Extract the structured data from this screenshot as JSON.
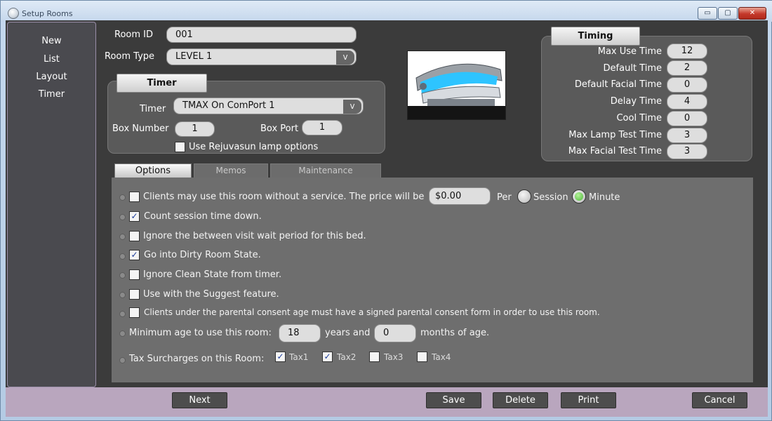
{
  "window": {
    "title": "Setup Rooms",
    "minimize": "▭",
    "maximize": "▢",
    "close": "✕"
  },
  "sidebar": {
    "items": [
      "New",
      "List",
      "Layout",
      "Timer"
    ]
  },
  "room": {
    "id_label": "Room ID",
    "id_value": "001",
    "type_label": "Room Type",
    "type_value": "LEVEL 1",
    "dropdown_glyph": "v"
  },
  "timer_group": {
    "title": "Timer",
    "timer_label": "Timer",
    "timer_value": "TMAX On ComPort 1",
    "box_number_label": "Box Number",
    "box_number_value": "1",
    "box_port_label": "Box Port",
    "box_port_value": "1",
    "rejuvasun_label": "Use Rejuvasun lamp options",
    "rejuvasun_checked": false
  },
  "timing": {
    "title": "Timing",
    "rows": [
      {
        "label": "Max Use Time",
        "value": "12"
      },
      {
        "label": "Default Time",
        "value": "2"
      },
      {
        "label": "Default Facial Time",
        "value": "0"
      },
      {
        "label": "Delay Time",
        "value": "4"
      },
      {
        "label": "Cool Time",
        "value": "0"
      },
      {
        "label": "Max Lamp Test Time",
        "value": "3"
      },
      {
        "label": "Max Facial Test Time",
        "value": "3"
      }
    ]
  },
  "tabs": [
    "Options",
    "Memos",
    "Maintenance"
  ],
  "options": {
    "no_service": {
      "label": "Clients may use this room without a service.  The price will be",
      "price": "$0.00",
      "per": "Per",
      "session": "Session",
      "minute": "Minute",
      "checked": false,
      "selected_unit": "Minute"
    },
    "count_down": {
      "label": "Count session time down.",
      "checked": true
    },
    "ignore_wait": {
      "label": "Ignore the between visit wait period for this bed.",
      "checked": false
    },
    "dirty_state": {
      "label": "Go into Dirty Room State.",
      "checked": true
    },
    "ignore_clean": {
      "label": "Ignore Clean State from timer.",
      "checked": false
    },
    "suggest": {
      "label": "Use with the Suggest feature.",
      "checked": false
    },
    "parental": {
      "label": "Clients under the parental consent age must have a signed parental consent form in order to use this room.",
      "checked": false
    },
    "min_age": {
      "label": "Minimum age to use this room:",
      "years": "18",
      "years_label": "years and",
      "months": "0",
      "months_label": "months of age."
    },
    "tax": {
      "label": "Tax Surcharges on this Room:",
      "items": [
        {
          "label": "Tax1",
          "checked": true
        },
        {
          "label": "Tax2",
          "checked": true
        },
        {
          "label": "Tax3",
          "checked": false
        },
        {
          "label": "Tax4",
          "checked": false
        }
      ]
    }
  },
  "footer": {
    "next": "Next",
    "save": "Save",
    "delete": "Delete",
    "print": "Print",
    "cancel": "Cancel"
  },
  "checkmark": "✓"
}
